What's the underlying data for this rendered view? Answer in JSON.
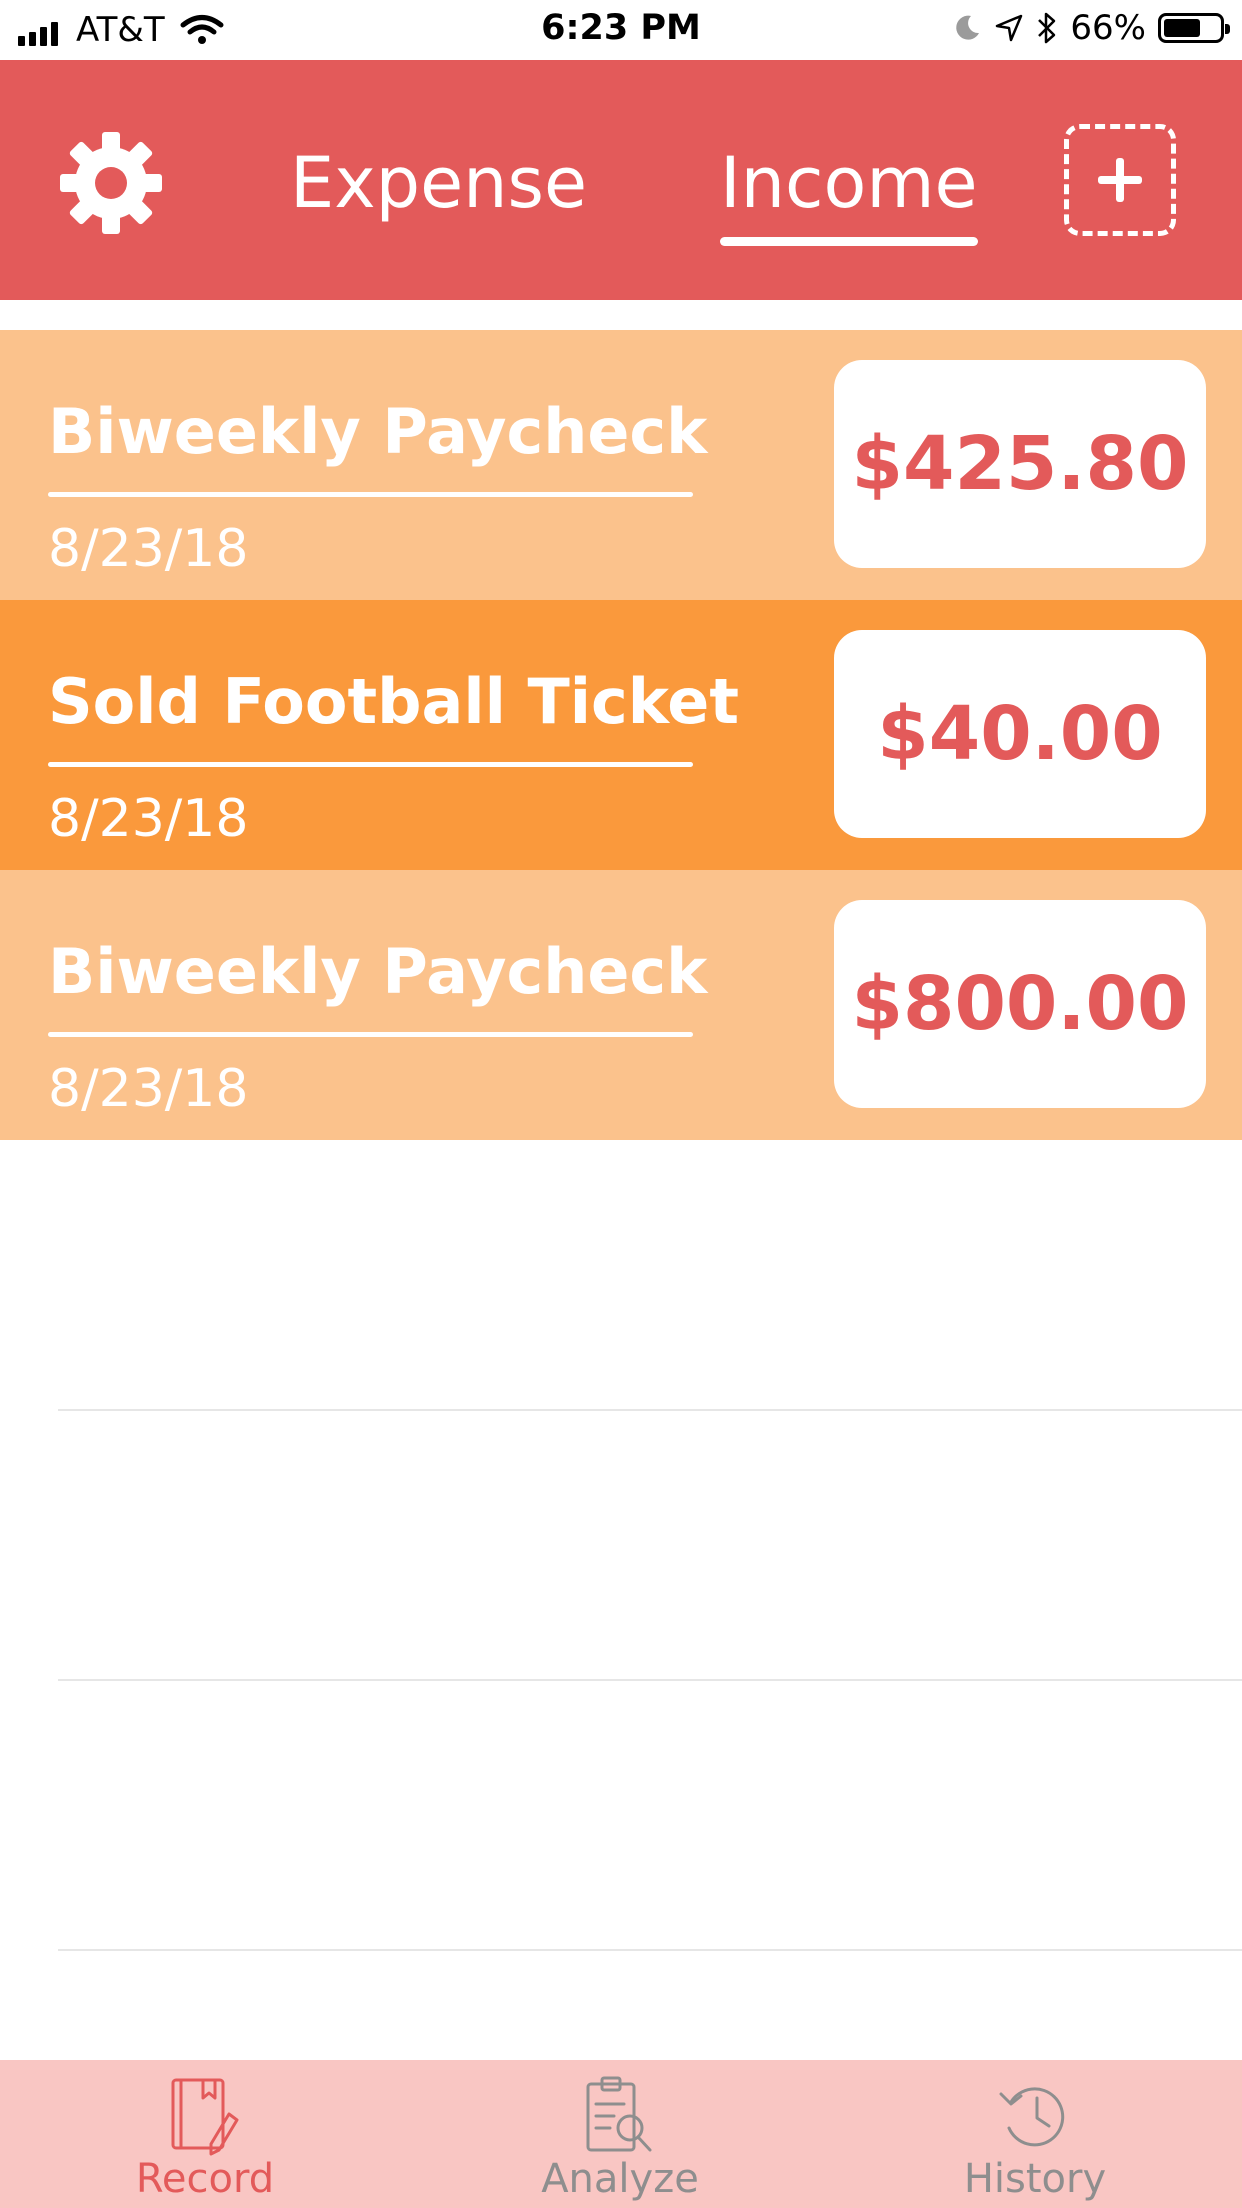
{
  "status_bar": {
    "carrier": "AT&T",
    "time": "6:23 PM",
    "battery_percent_label": "66%",
    "battery_level": 0.66
  },
  "header": {
    "tabs": [
      {
        "label": "Expense",
        "selected": false
      },
      {
        "label": "Income",
        "selected": true
      }
    ],
    "settings_icon": "gear-icon",
    "add_icon": "add-entry-icon",
    "color": "#e35a5a"
  },
  "entries": [
    {
      "title": "Biweekly Paycheck",
      "date": "8/23/18",
      "amount": "$425.80",
      "color": "#fbc28c"
    },
    {
      "title": "Sold Football Ticket",
      "date": "8/23/18",
      "amount": "$40.00",
      "color": "#fa993c"
    },
    {
      "title": "Biweekly Paycheck",
      "date": "8/23/18",
      "amount": "$800.00",
      "color": "#fbc28c"
    }
  ],
  "tab_bar": {
    "items": [
      {
        "label": "Record",
        "icon": "record-book-icon",
        "active": true
      },
      {
        "label": "Analyze",
        "icon": "analyze-clipboard-icon",
        "active": false
      },
      {
        "label": "History",
        "icon": "history-clock-icon",
        "active": false
      }
    ],
    "active_color": "#e35a5a",
    "inactive_color": "#8e8e8e",
    "background": "#f9c6c3"
  }
}
